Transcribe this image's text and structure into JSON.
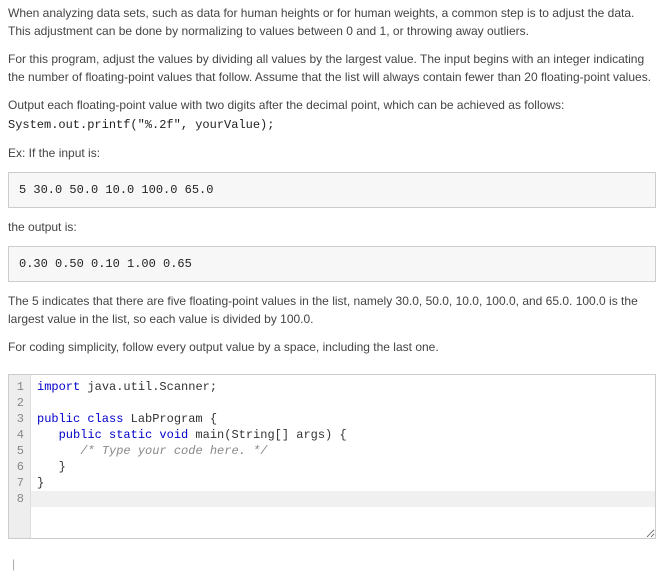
{
  "paragraphs": {
    "p1": "When analyzing data sets, such as data for human heights or for human weights, a common step is to adjust the data. This adjustment can be done by normalizing to values between 0 and 1, or throwing away outliers.",
    "p2": "For this program, adjust the values by dividing all values by the largest value. The input begins with an integer indicating the number of floating-point values that follow. Assume that the list will always contain fewer than 20 floating-point values.",
    "p3": "Output each floating-point value with two digits after the decimal point, which can be achieved as follows:",
    "p3_code": "System.out.printf(\"%.2f\", yourValue);",
    "p4": "Ex: If the input is:",
    "p5": "the output is:",
    "p6": "The 5 indicates that there are five floating-point values in the list, namely 30.0, 50.0, 10.0, 100.0, and 65.0. 100.0 is the largest value in the list, so each value is divided by 100.0.",
    "p7": "For coding simplicity, follow every output value by a space, including the last one."
  },
  "examples": {
    "input": "5 30.0 50.0 10.0 100.0 65.0",
    "output": "0.30 0.50 0.10 1.00 0.65"
  },
  "editor": {
    "line_numbers": [
      "1",
      "2",
      "3",
      "4",
      "5",
      "6",
      "7",
      "8"
    ],
    "lines": {
      "l1_kw": "import",
      "l1_rest": " java.util.Scanner;",
      "l2": "",
      "l3_kw": "public class",
      "l3_rest": " LabProgram {",
      "l4_pre": "   ",
      "l4_kw": "public static void",
      "l4_rest": " main(String[] args) {",
      "l5_pre": "      ",
      "l5_cm": "/* Type your code here. */",
      "l6": "   }",
      "l7": "}",
      "l8": ""
    }
  },
  "footer_caret": "|"
}
